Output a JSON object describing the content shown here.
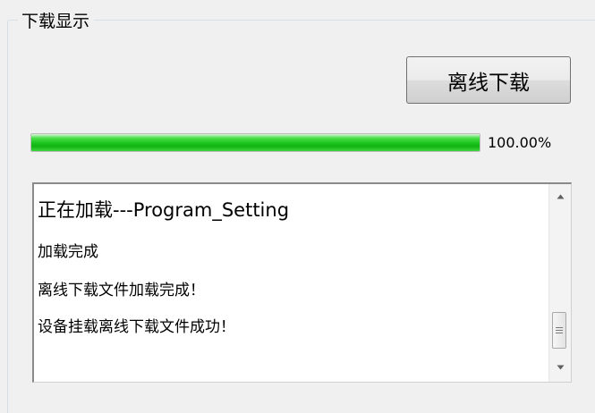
{
  "group": {
    "title": "下载显示"
  },
  "offline_button": {
    "label": "离线下载"
  },
  "progress": {
    "value": 1.0,
    "text": "100.00%"
  },
  "log": {
    "lines": [
      "正在加载---Program_Setting",
      "加载完成",
      "离线下载文件加载完成！",
      "设备挂载离线下载文件成功！"
    ]
  },
  "scrollbar": {
    "up_icon": "scroll-up-arrow",
    "down_icon": "scroll-down-arrow",
    "thumb_icon": "grip-lines"
  }
}
